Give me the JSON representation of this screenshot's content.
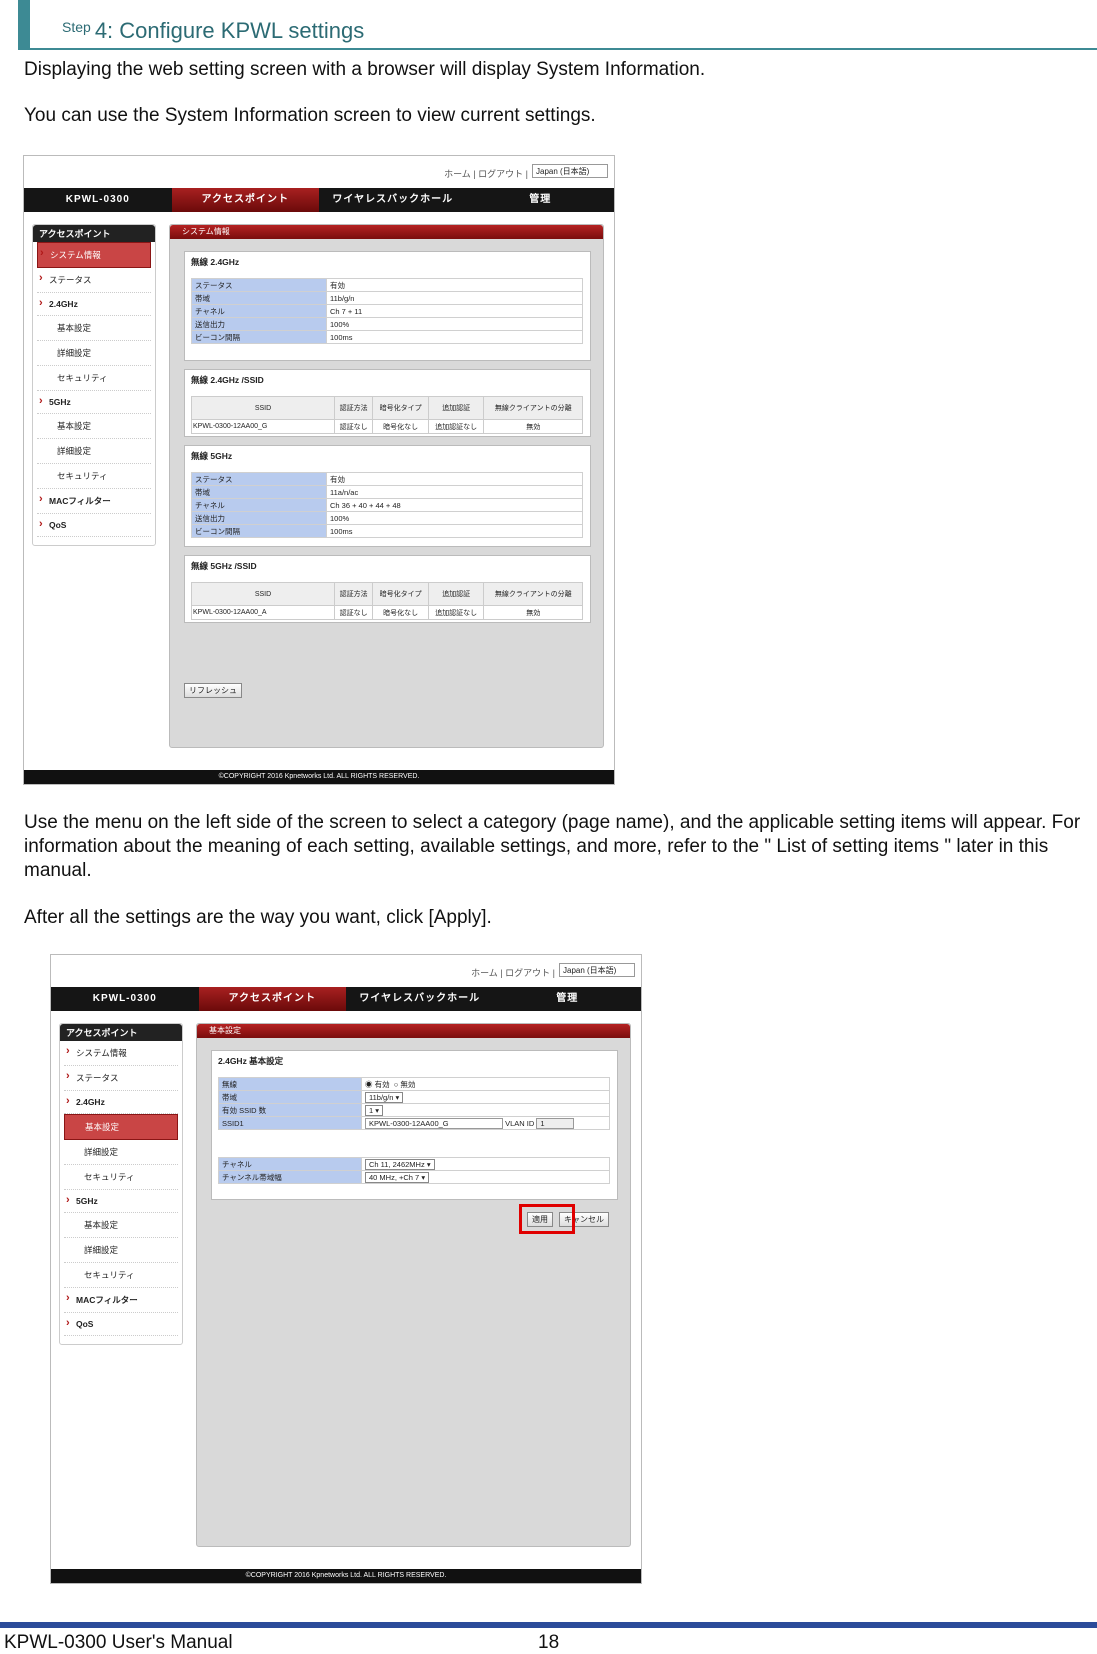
{
  "step": {
    "prefix": "Step",
    "title": "4: Configure KPWL settings"
  },
  "paragraphs": {
    "p1": "Displaying the web setting screen with a browser will display System Information.",
    "p2": "You can use the System Information screen to view current settings.",
    "p3": "Use the menu on the left side of the screen to select a category (page name), and the applicable setting items will appear. For information about the meaning of each setting, available settings, and more, refer to the \" List of setting items \" later in this manual.",
    "p4": "After all the settings are the way you want, click [Apply]."
  },
  "ui": {
    "top_links": "ホーム | ログアウト |",
    "language": "Japan (日本語)",
    "nav": [
      "KPWL-0300",
      "アクセスポイント",
      "ワイヤレスバックホール",
      "管理"
    ],
    "sidebar_head": "アクセスポイント",
    "sidebar": [
      "システム情報",
      "ステータス",
      "2.4GHz",
      "基本設定",
      "詳細設定",
      "セキュリティ",
      "5GHz",
      "基本設定",
      "詳細設定",
      "セキュリティ",
      "MACフィルター",
      "QoS"
    ],
    "footer": "©COPYRIGHT 2016 Kpnetworks Ltd. ALL RIGHTS RESERVED."
  },
  "screen1": {
    "header": "システム情報",
    "p24": {
      "title": "無線 2.4GHz",
      "rows": [
        [
          "ステータス",
          "有効"
        ],
        [
          "帯域",
          "11b/g/n"
        ],
        [
          "チャネル",
          "Ch 7 + 11"
        ],
        [
          "送信出力",
          "100%"
        ],
        [
          "ビーコン間隔",
          "100ms"
        ]
      ]
    },
    "s24": {
      "title": "無線 2.4GHz /SSID",
      "headers": [
        "SSID",
        "認証方法",
        "暗号化タイプ",
        "追加認証",
        "無線クライアントの分離"
      ],
      "row": [
        "KPWL-0300-12AA00_G",
        "認証なし",
        "暗号化なし",
        "追加認証なし",
        "無効"
      ]
    },
    "p5": {
      "title": "無線 5GHz",
      "rows": [
        [
          "ステータス",
          "有効"
        ],
        [
          "帯域",
          "11a/n/ac"
        ],
        [
          "チャネル",
          "Ch 36 + 40 + 44 + 48"
        ],
        [
          "送信出力",
          "100%"
        ],
        [
          "ビーコン間隔",
          "100ms"
        ]
      ]
    },
    "s5": {
      "title": "無線 5GHz /SSID",
      "headers": [
        "SSID",
        "認証方法",
        "暗号化タイプ",
        "追加認証",
        "無線クライアントの分離"
      ],
      "row": [
        "KPWL-0300-12AA00_A",
        "認証なし",
        "暗号化なし",
        "追加認証なし",
        "無効"
      ]
    },
    "refresh": "リフレッシュ"
  },
  "screen2": {
    "header": "基本設定",
    "panel_title": "2.4GHz 基本設定",
    "rows": {
      "wireless": "無線",
      "enabled": "有効",
      "disabled": "無効",
      "band": "帯域",
      "band_val": "11b/g/n",
      "ssid_count": "有効 SSID 数",
      "ssid_count_val": "1",
      "ssid1": "SSID1",
      "ssid1_val": "KPWL-0300-12AA00_G",
      "vlan": "VLAN ID",
      "vlan_val": "1",
      "channel": "チャネル",
      "channel_val": "Ch 11, 2462MHz",
      "width": "チャンネル帯域幅",
      "width_val": "40 MHz, +Ch 7"
    },
    "apply": "適用",
    "cancel": "キャンセル"
  },
  "footer": {
    "manual": "KPWL-0300 User's Manual",
    "page": "18"
  }
}
